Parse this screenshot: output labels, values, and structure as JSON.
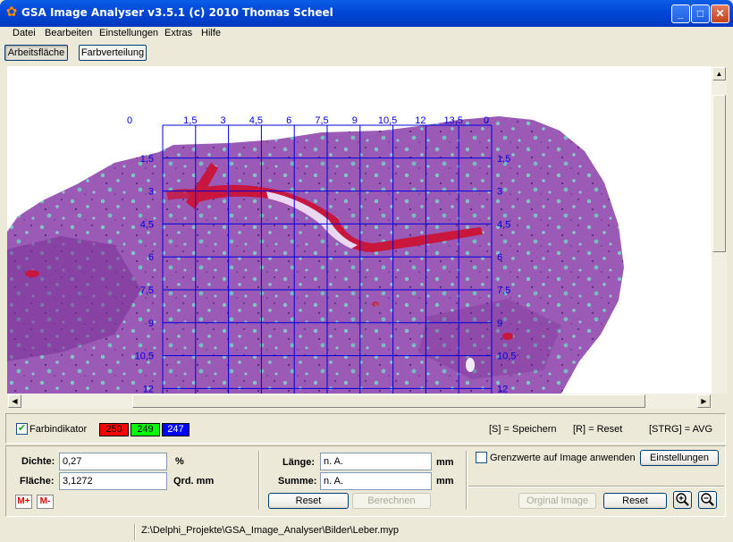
{
  "window": {
    "title": "GSA Image Analyser v3.5.1 (c) 2010   Thomas Scheel",
    "minimize": "_",
    "maximize": "□",
    "close": "✕"
  },
  "menu": [
    "Datei",
    "Bearbeiten",
    "Einstellungen",
    "Extras",
    "Hilfe"
  ],
  "tabs": {
    "work_area": "Arbeitsfläche",
    "color_distribution": "Farbverteilung"
  },
  "grid": {
    "top_labels": [
      "0",
      "1,5",
      "3",
      "4,5",
      "6",
      "7,5",
      "9",
      "10,5",
      "12",
      "13,5",
      "0"
    ],
    "row_labels": [
      "1,5",
      "3",
      "4,5",
      "6",
      "7,5",
      "9",
      "10,5",
      "12"
    ],
    "right_labels": [
      "0",
      "1,5",
      "3",
      "4,5",
      "6",
      "7,5",
      "9",
      "10,5",
      "12"
    ],
    "color": "#0000e0"
  },
  "color_indicator": {
    "label": "Farbindikator",
    "checked": true,
    "red": "250",
    "green": "249",
    "blue": "247",
    "red_color": "#ff0000",
    "green_color": "#00ff00",
    "blue_color": "#0000ff"
  },
  "hotkeys": {
    "save": "[S] = Speichern",
    "reset": "[R] = Reset",
    "avg": "[STRG] = AVG"
  },
  "density": {
    "label": "Dichte:",
    "value": "0,27",
    "unit": "%"
  },
  "area": {
    "label": "Fläche:",
    "value": "3,1272",
    "unit": "Qrd. mm"
  },
  "memory": {
    "plus": "M+",
    "minus": "M-"
  },
  "length": {
    "label": "Länge:",
    "value": "n. A.",
    "unit": "mm"
  },
  "sum": {
    "label": "Summe:",
    "value": "n. A.",
    "unit": "mm"
  },
  "calc_buttons": {
    "reset": "Reset",
    "calculate": "Berechnen"
  },
  "threshold": {
    "label": "Grenzwerte auf Image anwenden",
    "checked": false,
    "settings": "Einstellungen"
  },
  "image_buttons": {
    "original": "Orginal Image",
    "reset": "Reset",
    "zoom_in": "zoom-in-icon",
    "zoom_out": "zoom-out-icon"
  },
  "status": {
    "path": "Z:\\Delphi_Projekte\\GSA_Image_Analyser\\Bilder\\Leber.myp"
  },
  "tissue_colors": {
    "tissue": "#9a5ab6",
    "dark": "#7a2f95",
    "cyan": "#6fc6c2",
    "red": "#c8163c"
  }
}
